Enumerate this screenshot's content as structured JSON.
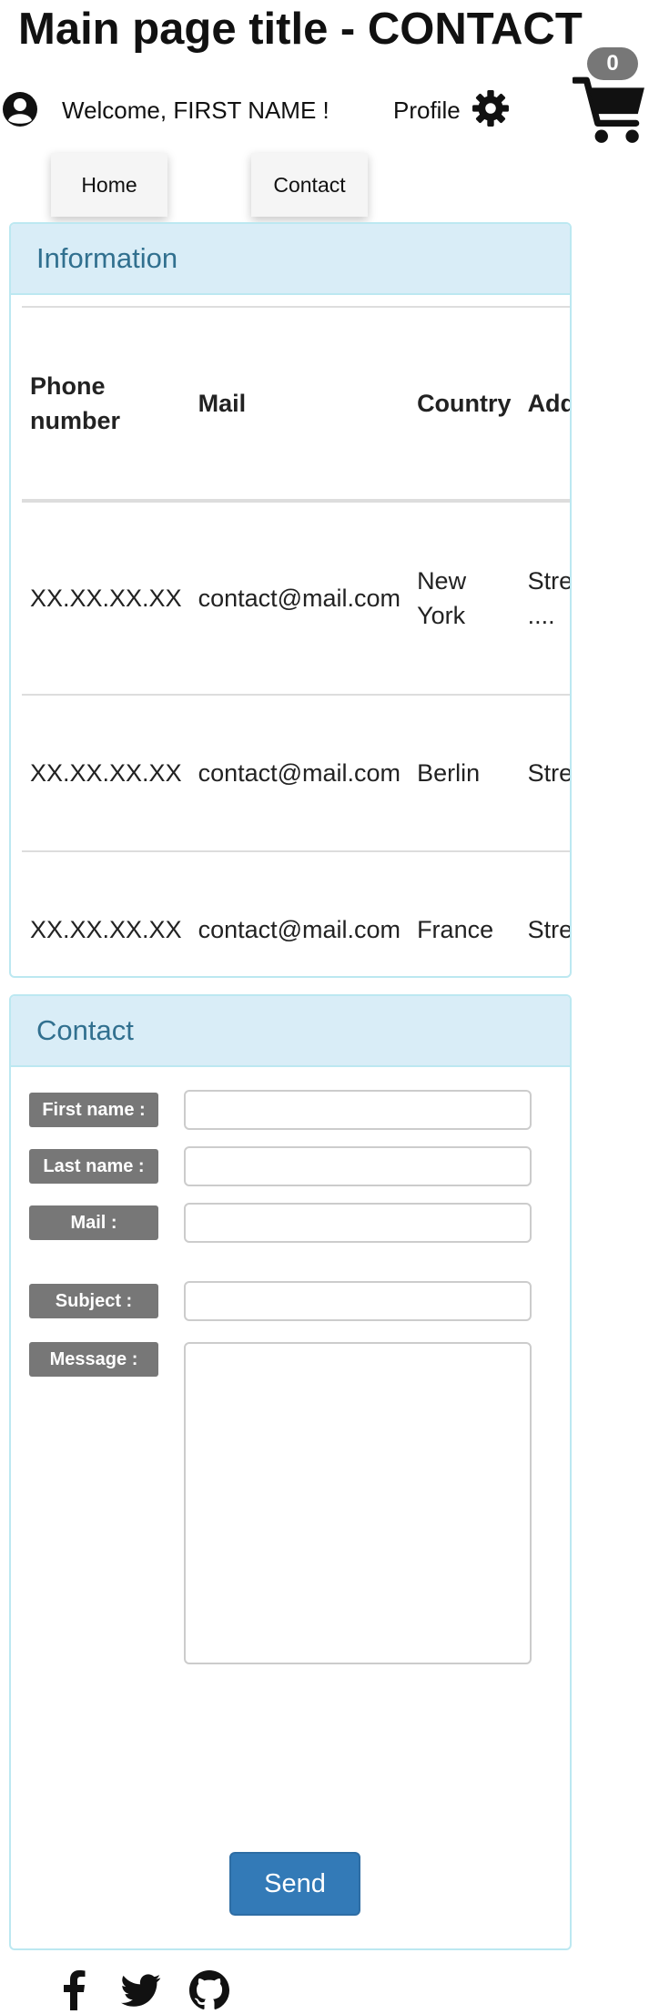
{
  "header": {
    "title": "Main page title - CONTACT",
    "welcome_text": "Welcome, FIRST NAME !",
    "profile_label": "Profile",
    "cart_count": "0"
  },
  "nav": {
    "tabs": [
      {
        "label": "Home"
      },
      {
        "label": "Contact"
      }
    ]
  },
  "information_panel": {
    "heading": "Information",
    "columns": [
      "Phone number",
      "Mail",
      "Country",
      "Address"
    ],
    "rows": [
      {
        "phone": "XX.XX.XX.XX",
        "mail": "contact@mail.com",
        "country": "New York",
        "address": "Street ...."
      },
      {
        "phone": "XX.XX.XX.XX",
        "mail": "contact@mail.com",
        "country": "Berlin",
        "address": "Street"
      },
      {
        "phone": "XX.XX.XX.XX",
        "mail": "contact@mail.com",
        "country": "France",
        "address": "Street"
      }
    ]
  },
  "contact_panel": {
    "heading": "Contact",
    "fields": [
      {
        "label": "First name :",
        "value": ""
      },
      {
        "label": "Last name :",
        "value": ""
      },
      {
        "label": "Mail :",
        "value": ""
      },
      {
        "label": "Subject :",
        "value": ""
      },
      {
        "label": "Message :",
        "value": ""
      }
    ],
    "send_label": "Send"
  },
  "footer": {
    "social_icons": [
      "facebook-icon",
      "twitter-icon",
      "github-icon"
    ]
  },
  "colors": {
    "panel_border": "#bce8f1",
    "panel_heading_bg": "#d9edf7",
    "panel_heading_text": "#31708f",
    "label_bg": "#777777",
    "button_primary": "#337ab7"
  }
}
